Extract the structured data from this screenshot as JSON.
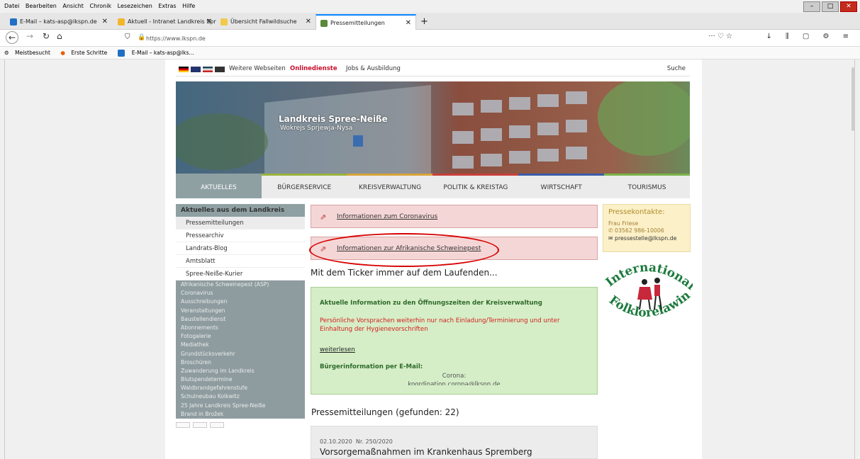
{
  "menubar": {
    "items": [
      "Datei",
      "Bearbeiten",
      "Ansicht",
      "Chronik",
      "Lesezeichen",
      "Extras",
      "Hilfe"
    ]
  },
  "tabs": [
    {
      "label": "E-Mail – kats-asp@lkspn.de",
      "icon": "outlook-icon"
    },
    {
      "label": "Aktuell - Intranet Landkreis Spr",
      "icon": "intranet-icon"
    },
    {
      "label": "Übersicht Fallwildsuche",
      "icon": "folder-icon"
    },
    {
      "label": "Pressemitteilungen",
      "icon": "lkspn-icon"
    }
  ],
  "url": "https://www.lkspn.de",
  "bookmarks": [
    "Meistbesucht",
    "Erste Schritte",
    "E-Mail – kats-asp@lks..."
  ],
  "site": {
    "topbar": {
      "weitere": "Weitere Webseiten",
      "online": "Onlinedienste",
      "jobs": "Jobs & Ausbildung",
      "suche": "Suche"
    },
    "header_title": "Landkreis Spree-Neiße",
    "header_sub": "Wokrejs Sprjewja-Nysa",
    "nav": [
      {
        "label": "AKTUELLES",
        "color": "#8fa0a3"
      },
      {
        "label": "BÜRGERSERVICE",
        "color": "#9ab23c"
      },
      {
        "label": "KREISVERWALTUNG",
        "color": "#d8a43a"
      },
      {
        "label": "POLITIK & KREISTAG",
        "color": "#c8403b"
      },
      {
        "label": "WIRTSCHAFT",
        "color": "#3a5ca8"
      },
      {
        "label": "TOURISMUS",
        "color": "#7ab34a"
      }
    ],
    "sidebar": {
      "heading": "Aktuelles aus dem Landkreis",
      "white_items": [
        "Pressemitteilungen",
        "Pressearchiv",
        "Landrats-Blog",
        "Amtsblatt",
        "Spree-Neiße-Kurier"
      ],
      "grey_items": [
        "Afrikanische Schweinepest (ASP)",
        "Coronavirus",
        "Ausschreibungen",
        "Veranstaltungen",
        "Baustellendienst",
        "Abonnements",
        "Fotogalerie",
        "Mediathek",
        "Grundstücksverkehr",
        "Broschüren",
        "Zuwanderung im Landkreis",
        "Blutspendetermine",
        "Waldbrandgefahrenstufe",
        "Schulneubau Kolkwitz",
        "25 Jahre Landkreis Spree-Neiße",
        "Brand in Brožek"
      ]
    },
    "links": [
      "Informationen zum Coronavirus",
      "Informationen zur Afrikanische Schweinepest"
    ],
    "ticker": "Mit dem Ticker immer auf dem Laufenden...",
    "green": {
      "title": "Aktuelle Information zu den Öffnungszeiten der Kreisverwaltung",
      "red": "Persönliche Vorsprachen weiterhin nur nach Einladung/Terminierung und unter Einhaltung der Hygienevorschriften",
      "more": "weiterlesen",
      "b": "Bürgerinformation per E-Mail:",
      "c1": "Corona:",
      "c2": "koordination.corona@lkspn.de"
    },
    "pm_heading": "Pressemitteilungen (gefunden: 22)",
    "pm_item": {
      "date": "02.10.2020",
      "nr": "Nr. 250/2020",
      "title": "Vorsorgemaßnahmen im Krankenhaus Spremberg"
    },
    "presse": {
      "heading": "Pressekontakte:",
      "name": "Frau Friese",
      "phone": "03562 986-10006",
      "mail": "pressestelle@lkspn.de"
    },
    "logo_top": "Internationale",
    "logo_bottom": "Folklorelawine"
  }
}
